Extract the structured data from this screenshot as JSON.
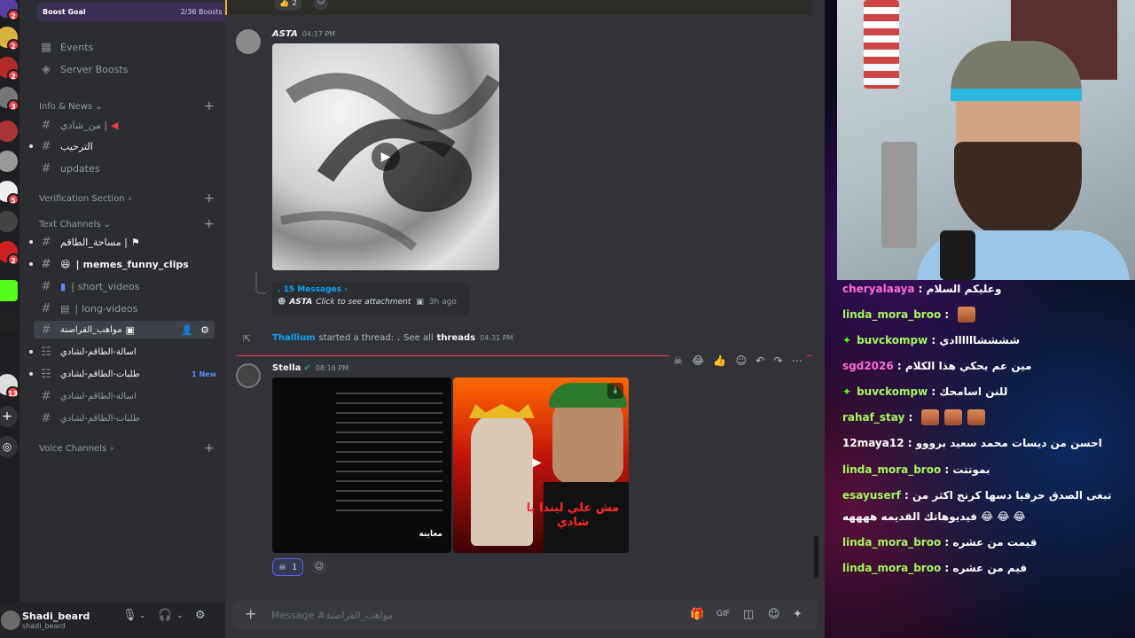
{
  "sidebar": {
    "boost_goal": {
      "label": "Boost Goal",
      "value": "2/36 Boosts"
    },
    "events_label": "Events",
    "server_boosts_label": "Server Boosts",
    "cat_info": "Info & News",
    "ch_min_shadi": "من_شادي |",
    "ch_welcome": "الترحيب",
    "ch_updates": "updates",
    "cat_verification": "Verification Section",
    "cat_text": "Text Channels",
    "ch_masaha": "مساحة_الطاقم |",
    "ch_memes": "memes_funny_clips",
    "ch_shorts": "short_videos",
    "ch_long": "long-videos",
    "ch_mawaheb": "مواهب_القراصنة",
    "ch_as2ela": "اسالة-الطاقم-لشادي",
    "ch_talabat": "طلبات-الطاقم-لشادي",
    "new_label": "1 New",
    "ch_as2ela2": "اسالة-الطاقم-لشادي",
    "ch_talabat2": "طلبات-الطاقم-لشادي",
    "cat_voice": "Voice Channels"
  },
  "user": {
    "name": "Shadi_beard",
    "status": "shadi_beard"
  },
  "server_badges": [
    "2",
    "2",
    "2",
    "3",
    "5",
    "2",
    "13"
  ],
  "messages": {
    "reaction_top_count": "2",
    "m1_author": "ASTA",
    "m1_time": "04:17 PM",
    "thread_count": "15 Messages",
    "thread_author": "ASTA",
    "thread_preview": "Click to see attachment",
    "thread_time": "3h ago",
    "system_user": "Thallium",
    "system_text": "started a thread:",
    "system_dot": ".",
    "system_see_all": "See all",
    "system_threads": "threads",
    "system_time": "04:31 PM",
    "m2_author": "Stella",
    "m2_time": "08:16 PM",
    "m2_reaction_count": "1",
    "doc_caption": "معاينة",
    "meme_text": "مش علي ليندا يا شادي"
  },
  "composer": {
    "placeholder": "Message #مواهب_القراصنة"
  },
  "stream_chat": [
    {
      "user": "cheryalaaya",
      "text": "وعليكم السلام",
      "user_color": "#ff6ad5"
    },
    {
      "user": "linda_mora_broo",
      "text": "",
      "emotes": 1
    },
    {
      "user": "buvckompw",
      "text": "ششششاااااادي",
      "badge": true
    },
    {
      "user": "sgd2026",
      "text": "مين عم يحكي هذا الكلام",
      "user_color": "#ff6ad5"
    },
    {
      "user": "buvckompw",
      "text": "للنن اسامحك",
      "badge": true
    },
    {
      "user": "rahaf_stay",
      "text": "",
      "emotes": 3
    },
    {
      "user": "12maya12",
      "text": "احسن من ديسات محمد سعيد برووو",
      "user_color": "#ffffff"
    },
    {
      "user": "linda_mora_broo",
      "text": "بموتتت"
    },
    {
      "user": "esayuserf",
      "text": "تبغى الصدق حرفيا دسها كرنج اكثر من"
    },
    {
      "user": "",
      "text": "فيديوهاتك القديمه ههههه 😂 😂 😂"
    },
    {
      "user": "linda_mora_broo",
      "text": "قيمت من عشره"
    },
    {
      "user": "linda_mora_broo",
      "text": "قيم من عشره"
    }
  ]
}
